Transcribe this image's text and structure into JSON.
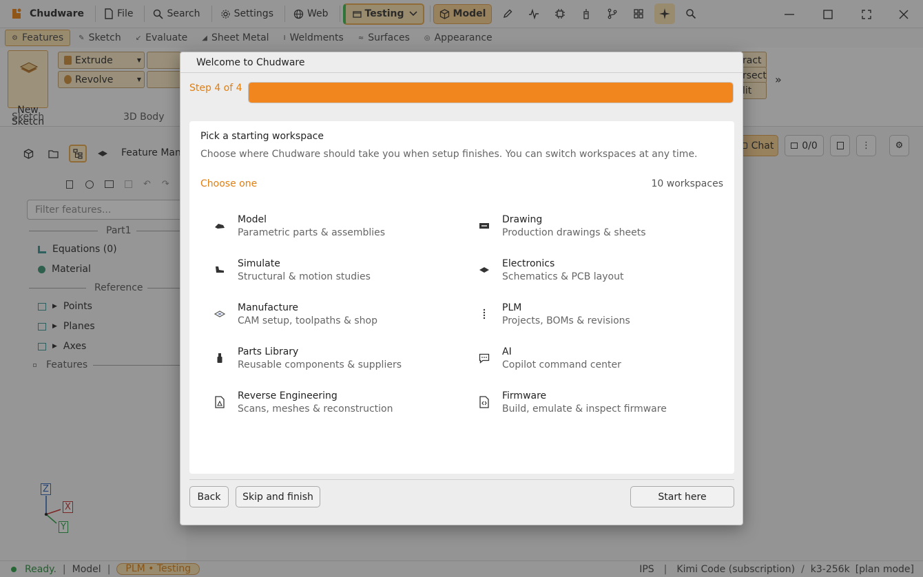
{
  "app": {
    "name": "Chudware"
  },
  "titlebar": {
    "file": "File",
    "search": "Search",
    "settings": "Settings",
    "web": "Web",
    "workspace_selector": "Testing",
    "mode": "Model"
  },
  "ribbon": {
    "tabs": [
      "Features",
      "Sketch",
      "Evaluate",
      "Sheet Metal",
      "Weldments",
      "Surfaces",
      "Appearance"
    ],
    "new_sketch": "New\nSketch",
    "extrude": "Extrude",
    "revolve": "Revolve",
    "groups": {
      "sketch": "Sketch",
      "body": "3D Body"
    },
    "partial_right": [
      "ract",
      "rsect",
      "lit"
    ],
    "more": "»"
  },
  "left_panel": {
    "feature_manager": "Feature Man",
    "filter_placeholder": "Filter features...",
    "part": "Part1",
    "equations": "Equations (0)",
    "material": "Material",
    "reference": "Reference",
    "points": "Points",
    "planes": "Planes",
    "axes": "Axes",
    "features": "Features"
  },
  "triad": {
    "z": "Z",
    "x": "X",
    "y": "Y"
  },
  "right_controls": {
    "chat": "Chat",
    "counter": "0/0"
  },
  "statusbar": {
    "ready": "Ready.",
    "mode": "Model",
    "pill": "PLM • Testing",
    "units": "IPS",
    "model": "Kimi Code (subscription)",
    "context": "k3-256k",
    "plan": "[plan mode]"
  },
  "modal": {
    "title": "Welcome to Chudware",
    "step": "Step 4 of 4",
    "progress": 1.0,
    "heading": "Pick a starting workspace",
    "description": "Choose where Chudware should take you when setup finishes. You can switch workspaces at any time.",
    "choose": "Choose one",
    "count": "10 workspaces",
    "workspaces": [
      {
        "name": "Model",
        "desc": "Parametric parts & assemblies",
        "icon": "model-icon"
      },
      {
        "name": "Drawing",
        "desc": "Production drawings & sheets",
        "icon": "drawing-icon"
      },
      {
        "name": "Simulate",
        "desc": "Structural & motion studies",
        "icon": "simulate-icon"
      },
      {
        "name": "Electronics",
        "desc": "Schematics & PCB layout",
        "icon": "electronics-icon"
      },
      {
        "name": "Manufacture",
        "desc": "CAM setup, toolpaths & shop",
        "icon": "manufacture-icon"
      },
      {
        "name": "PLM",
        "desc": "Projects, BOMs & revisions",
        "icon": "plm-icon"
      },
      {
        "name": "Parts Library",
        "desc": "Reusable components & suppliers",
        "icon": "parts-library-icon"
      },
      {
        "name": "AI",
        "desc": "Copilot command center",
        "icon": "chat-icon"
      },
      {
        "name": "Reverse Engineering",
        "desc": "Scans, meshes & reconstruction",
        "icon": "scan-icon"
      },
      {
        "name": "Firmware",
        "desc": "Build, emulate & inspect firmware",
        "icon": "code-file-icon"
      }
    ],
    "back": "Back",
    "skip": "Skip and finish",
    "start": "Start here"
  },
  "colors": {
    "accent": "#f2861e",
    "accent_soft": "#f2d9a7",
    "ok": "#2c9a45"
  }
}
